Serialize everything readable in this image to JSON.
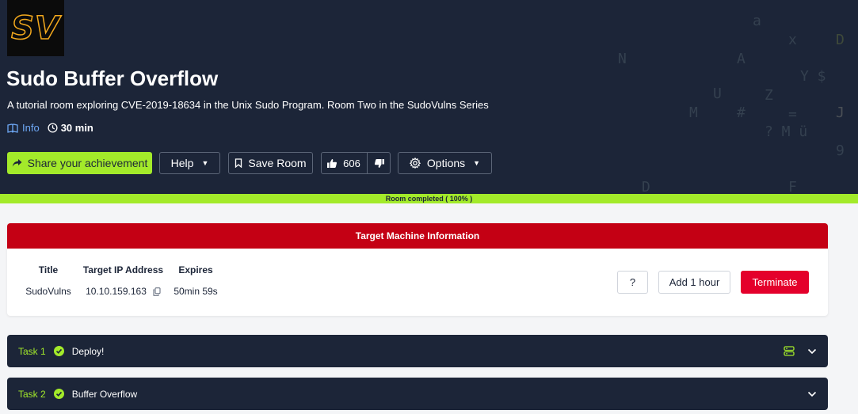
{
  "logo": {
    "text": "SV",
    "color": "#f2a81d"
  },
  "room": {
    "title": "Sudo Buffer Overflow",
    "description": "A tutorial room exploring CVE-2019-18634 in the Unix Sudo Program. Room Two in the SudoVulns Series",
    "info_label": "Info",
    "duration": "30 min"
  },
  "actions": {
    "share_label": "Share your achievement",
    "help_label": "Help",
    "save_label": "Save Room",
    "vote_count": "606",
    "options_label": "Options"
  },
  "progress": {
    "label": "Room completed ( 100% )",
    "percent": 100
  },
  "target_machine": {
    "header": "Target Machine Information",
    "columns": [
      {
        "header": "Title",
        "value": "SudoVulns"
      },
      {
        "header": "Target IP Address",
        "value": "10.10.159.163"
      },
      {
        "header": "Expires",
        "value": "50min 59s"
      }
    ],
    "help_label": "?",
    "add_hour_label": "Add 1 hour",
    "terminate_label": "Terminate"
  },
  "tasks": [
    {
      "label": "Task 1",
      "name": "Deploy!",
      "completed": true,
      "has_machine_icon": true
    },
    {
      "label": "Task 2",
      "name": "Buffer Overflow",
      "completed": true,
      "has_machine_icon": false
    }
  ],
  "colors": {
    "hero_bg": "#1c2538",
    "accent_green": "#a3ea2a",
    "banner_red": "#c40014",
    "terminate_red": "#e4002b",
    "info_blue": "#6ea8f5"
  }
}
